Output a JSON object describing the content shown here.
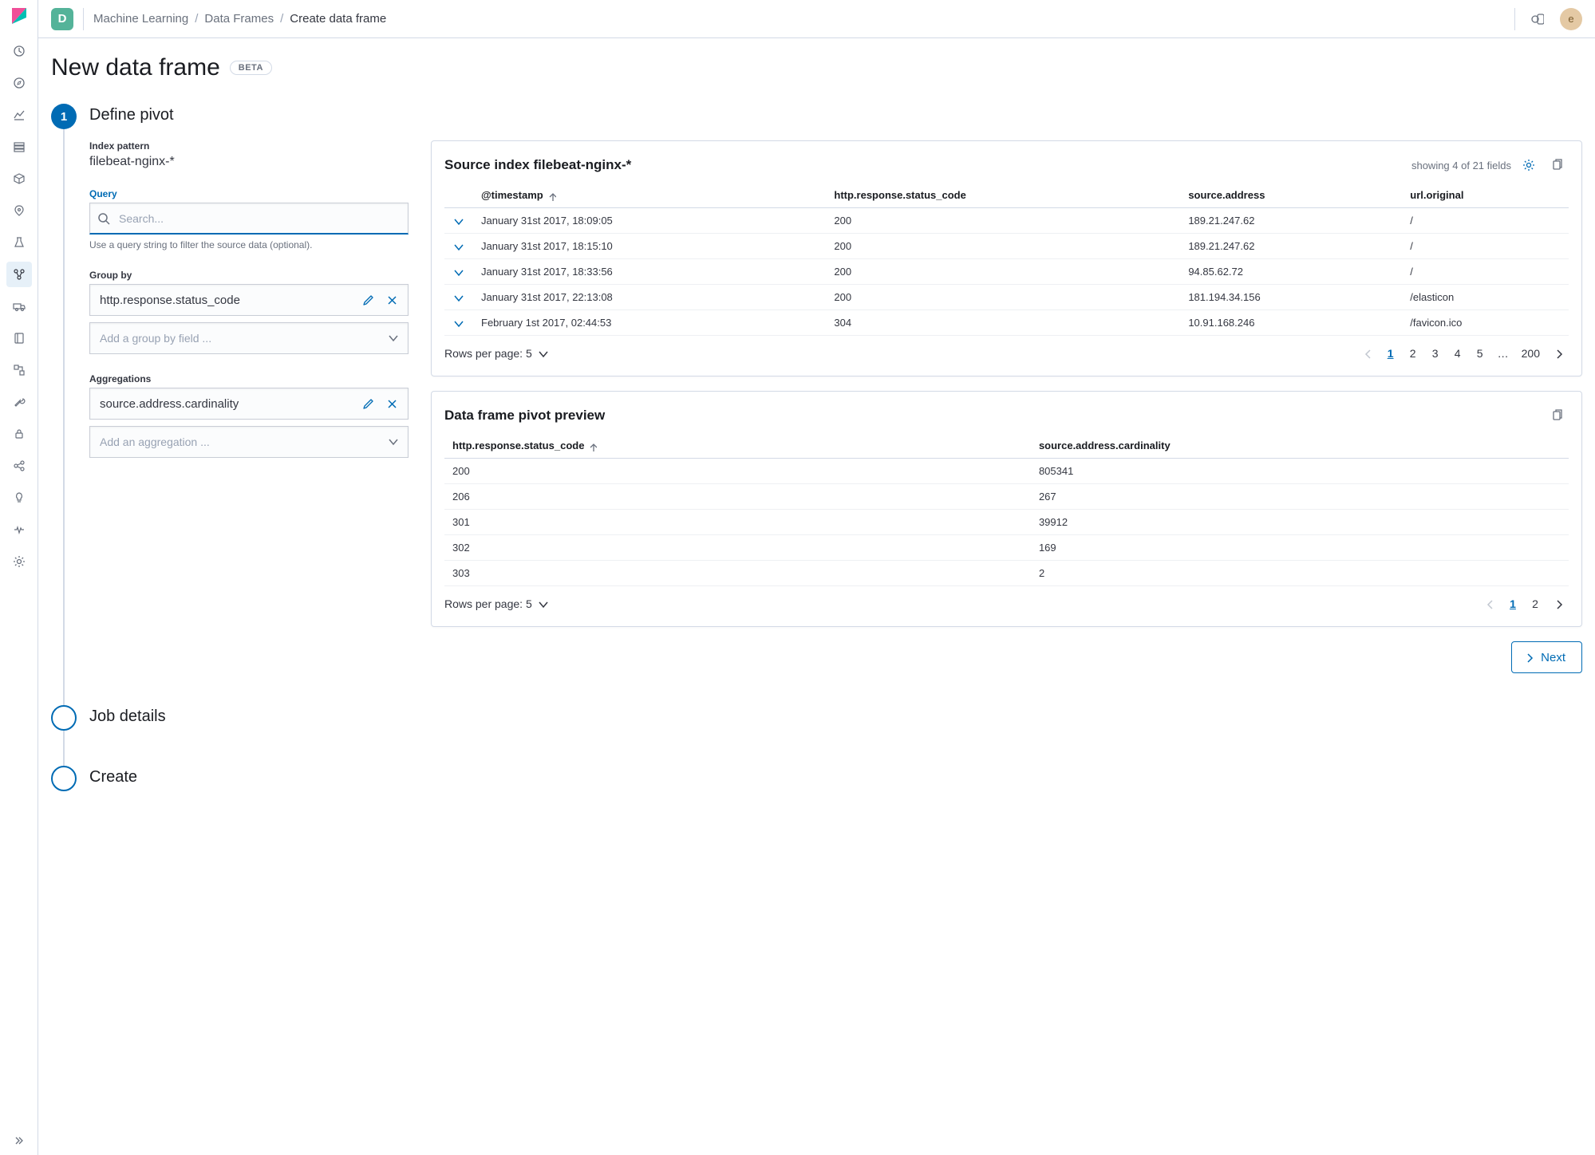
{
  "header": {
    "space_initial": "D",
    "breadcrumbs": [
      "Machine Learning",
      "Data Frames",
      "Create data frame"
    ],
    "avatar_initial": "e"
  },
  "page": {
    "title": "New data frame",
    "badge": "BETA"
  },
  "steps": {
    "define_pivot": {
      "number": "1",
      "title": "Define pivot",
      "index_pattern_label": "Index pattern",
      "index_pattern_value": "filebeat-nginx-*",
      "query_label": "Query",
      "query_placeholder": "Search...",
      "query_help": "Use a query string to filter the source data (optional).",
      "group_by_label": "Group by",
      "group_by_value": "http.response.status_code",
      "group_by_placeholder": "Add a group by field ...",
      "aggregations_label": "Aggregations",
      "aggregations_value": "source.address.cardinality",
      "aggregations_placeholder": "Add an aggregation ..."
    },
    "job_details": {
      "title": "Job details"
    },
    "create": {
      "title": "Create"
    }
  },
  "source_panel": {
    "title": "Source index filebeat-nginx-*",
    "showing_text": "showing 4 of 21 fields",
    "columns": [
      "@timestamp",
      "http.response.status_code",
      "source.address",
      "url.original"
    ],
    "rows": [
      {
        "timestamp": "January 31st 2017, 18:09:05",
        "status": "200",
        "address": "189.21.247.62",
        "url": "/"
      },
      {
        "timestamp": "January 31st 2017, 18:15:10",
        "status": "200",
        "address": "189.21.247.62",
        "url": "/"
      },
      {
        "timestamp": "January 31st 2017, 18:33:56",
        "status": "200",
        "address": "94.85.62.72",
        "url": "/"
      },
      {
        "timestamp": "January 31st 2017, 22:13:08",
        "status": "200",
        "address": "181.194.34.156",
        "url": "/elasticon"
      },
      {
        "timestamp": "February 1st 2017, 02:44:53",
        "status": "304",
        "address": "10.91.168.246",
        "url": "/favicon.ico"
      }
    ],
    "rows_per_page": "Rows per page: 5",
    "pages": [
      "1",
      "2",
      "3",
      "4",
      "5",
      "…",
      "200"
    ]
  },
  "preview_panel": {
    "title": "Data frame pivot preview",
    "columns": [
      "http.response.status_code",
      "source.address.cardinality"
    ],
    "rows": [
      {
        "code": "200",
        "card": "805341"
      },
      {
        "code": "206",
        "card": "267"
      },
      {
        "code": "301",
        "card": "39912"
      },
      {
        "code": "302",
        "card": "169"
      },
      {
        "code": "303",
        "card": "2"
      }
    ],
    "rows_per_page": "Rows per page: 5",
    "pages": [
      "1",
      "2"
    ]
  },
  "next_label": "Next"
}
